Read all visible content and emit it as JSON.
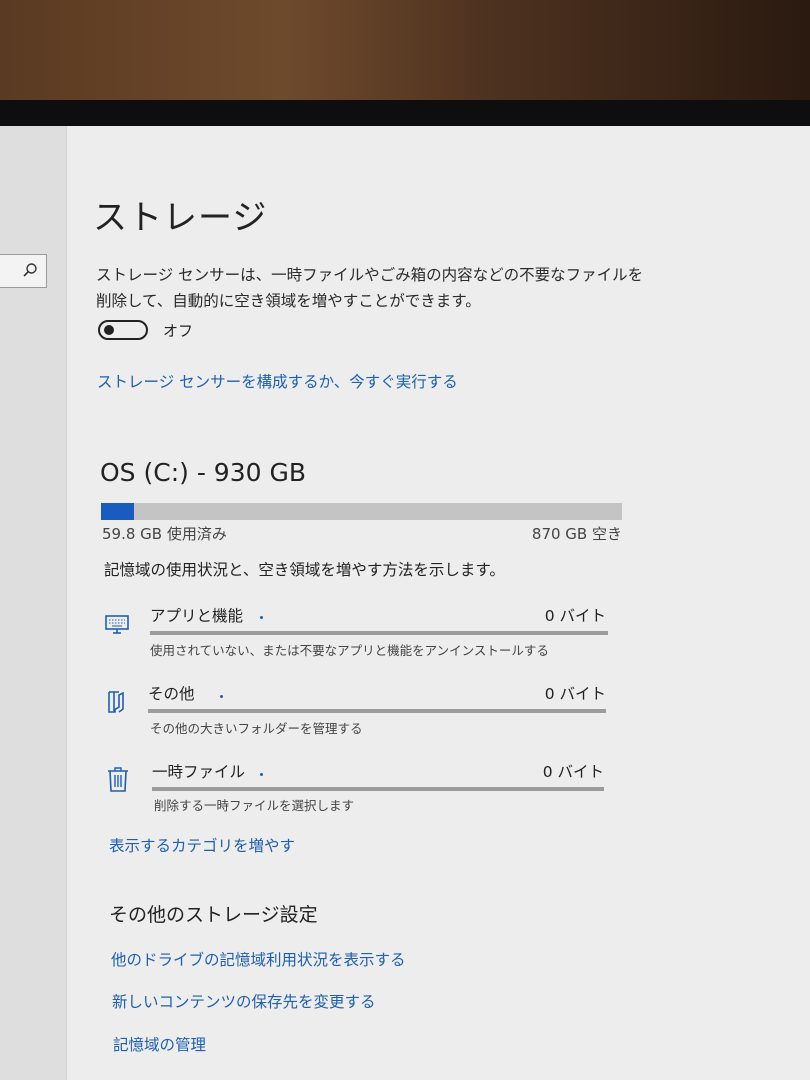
{
  "page": {
    "title": "ストレージ",
    "sensor_description": "ストレージ センサーは、一時ファイルやごみ箱の内容などの不要なファイルを削除して、自動的に空き領域を増やすことができます。",
    "toggle_label": "オフ",
    "toggle_state": "off",
    "configure_link": "ストレージ センサーを構成するか、今すぐ実行する"
  },
  "drive": {
    "title": "OS (C:) - 930 GB",
    "used_label": "59.8 GB 使用済み",
    "free_label": "870 GB 空き",
    "used_fraction": 0.064,
    "summary": "記憶域の使用状況と、空き領域を増やす方法を示します。"
  },
  "categories": [
    {
      "name": "アプリと機能",
      "size": "0 バイト",
      "subtitle": "使用されていない、または不要なアプリと機能をアンインストールする",
      "icon": "keyboard-icon"
    },
    {
      "name": "その他",
      "size": "0 バイト",
      "subtitle": "その他の大きいフォルダーを管理する",
      "icon": "folder-icon"
    },
    {
      "name": "一時ファイル",
      "size": "0 バイト",
      "subtitle": "削除する一時ファイルを選択します",
      "icon": "trash-icon"
    }
  ],
  "show_more_link": "表示するカテゴリを増やす",
  "more_settings": {
    "heading": "その他のストレージ設定",
    "links": [
      "他のドライブの記憶域利用状況を表示する",
      "新しいコンテンツの保存先を変更する",
      "記憶域の管理"
    ]
  },
  "colors": {
    "accent": "#1a5bbf",
    "link": "#1f5fae",
    "bar_background": "#c4c4c4",
    "page_background": "#ededed"
  }
}
